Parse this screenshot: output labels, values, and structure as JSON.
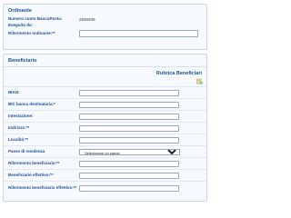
{
  "ordinante": {
    "title": "Ordinante",
    "rows": [
      {
        "label": "Numero conto BancoPosta:",
        "value": "2830409"
      },
      {
        "label": "Eseguito da:",
        "value": ""
      }
    ],
    "riferimento_label": "Riferimento ordinante:**",
    "riferimento_value": ""
  },
  "beneficiario": {
    "title": "Beneficiario",
    "rubrica_label": "Rubrica Beneficiari",
    "rubrica_icon": "address-book-add-icon",
    "fields": {
      "iban": {
        "label": "IBAN:",
        "value": ""
      },
      "bic": {
        "label": "BIC banca destinataria:*",
        "value": ""
      },
      "intestazione": {
        "label": "Intestazione:",
        "value": ""
      },
      "indirizzo": {
        "label": "Indirizzo:**",
        "value": ""
      },
      "localita": {
        "label": "Località:**",
        "value": ""
      },
      "paese": {
        "label": "Paese di residenza",
        "selected": "Selezionare un paese"
      },
      "rif_beneficiario": {
        "label": "Riferimento beneficiario:**",
        "value": ""
      },
      "benef_effettivo": {
        "label": "Beneficiario effettivo:**",
        "value": ""
      },
      "rif_benef_effettivo": {
        "label": "Riferimento beneficiario effettivo:**",
        "value": ""
      }
    }
  },
  "colors": {
    "heading": "#1d4e96",
    "panel_bg": "#f6f9fd",
    "border": "#c9d6e8"
  }
}
